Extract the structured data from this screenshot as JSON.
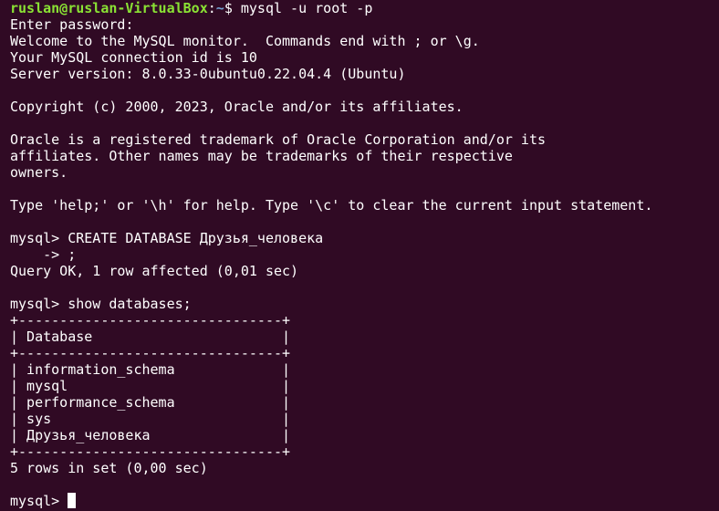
{
  "terminal": {
    "colors": {
      "background": "#300a24",
      "foreground": "#ffffff",
      "user_host": "#8ae234",
      "path": "#729fcf"
    },
    "prompt": {
      "user_host": "ruslan@ruslan-VirtualBox",
      "separator": ":",
      "path": "~",
      "symbol": "$ ",
      "command": "mysql -u root -p"
    },
    "output": [
      "Enter password:",
      "Welcome to the MySQL monitor.  Commands end with ; or \\g.",
      "Your MySQL connection id is 10",
      "Server version: 8.0.33-0ubuntu0.22.04.4 (Ubuntu)",
      "",
      "Copyright (c) 2000, 2023, Oracle and/or its affiliates.",
      "",
      "Oracle is a registered trademark of Oracle Corporation and/or its",
      "affiliates. Other names may be trademarks of their respective",
      "owners.",
      "",
      "Type 'help;' or '\\h' for help. Type '\\c' to clear the current input statement.",
      "",
      "mysql> CREATE DATABASE Друзья_человека",
      "    -> ;",
      "Query OK, 1 row affected (0,01 sec)",
      "",
      "mysql> show databases;",
      "+--------------------------------+",
      "| Database                       |",
      "+--------------------------------+",
      "| information_schema             |",
      "| mysql                          |",
      "| performance_schema             |",
      "| sys                            |",
      "| Друзья_человека                |",
      "+--------------------------------+",
      "5 rows in set (0,00 sec)",
      ""
    ],
    "current_prompt": "mysql> "
  }
}
